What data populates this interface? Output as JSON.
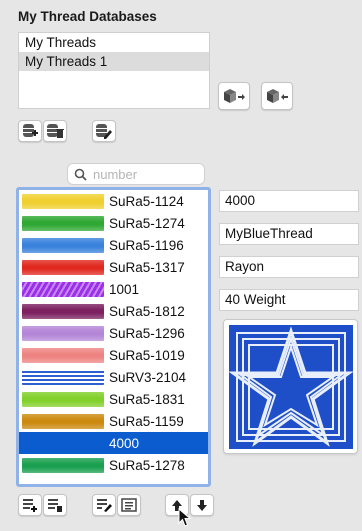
{
  "panel": {
    "title": "My Thread Databases"
  },
  "databases": [
    {
      "label": "My Threads",
      "selected": false
    },
    {
      "label": "My Threads 1",
      "selected": true
    }
  ],
  "search": {
    "placeholder": "number",
    "value": ""
  },
  "threads": [
    {
      "label": "SuRa5-1124",
      "color": "#f0d030",
      "selected": false
    },
    {
      "label": "SuRa5-1274",
      "color": "#2fa833",
      "selected": false
    },
    {
      "label": "SuRa5-1196",
      "color": "#3a82dc",
      "selected": false
    },
    {
      "label": "SuRa5-1317",
      "color": "#e02a20",
      "selected": false
    },
    {
      "label": "1001",
      "color": "#9b30e8",
      "selected": false
    },
    {
      "label": "SuRa5-1812",
      "color": "#7c2060",
      "selected": false
    },
    {
      "label": "SuRa5-1296",
      "color": "#b486d8",
      "selected": false
    },
    {
      "label": "SuRa5-1019",
      "color": "#ee8482",
      "selected": false
    },
    {
      "label": "SuRV3-2104",
      "color": "#2d5fcf",
      "selected": false
    },
    {
      "label": "SuRa5-1831",
      "color": "#82d02a",
      "selected": false
    },
    {
      "label": "SuRa5-1159",
      "color": "#cc8a10",
      "selected": false
    },
    {
      "label": "4000",
      "color": "#0a5ccf",
      "selected": true
    },
    {
      "label": "SuRa5-1278",
      "color": "#1aa050",
      "selected": false
    }
  ],
  "details": {
    "number": "4000",
    "name": "MyBlueThread",
    "type": "Rayon",
    "weight": "40 Weight"
  },
  "colors": {
    "selection": "#0a5ccf",
    "list_border": "#8fb3e8",
    "preview_blue": "#1f4fc8"
  }
}
